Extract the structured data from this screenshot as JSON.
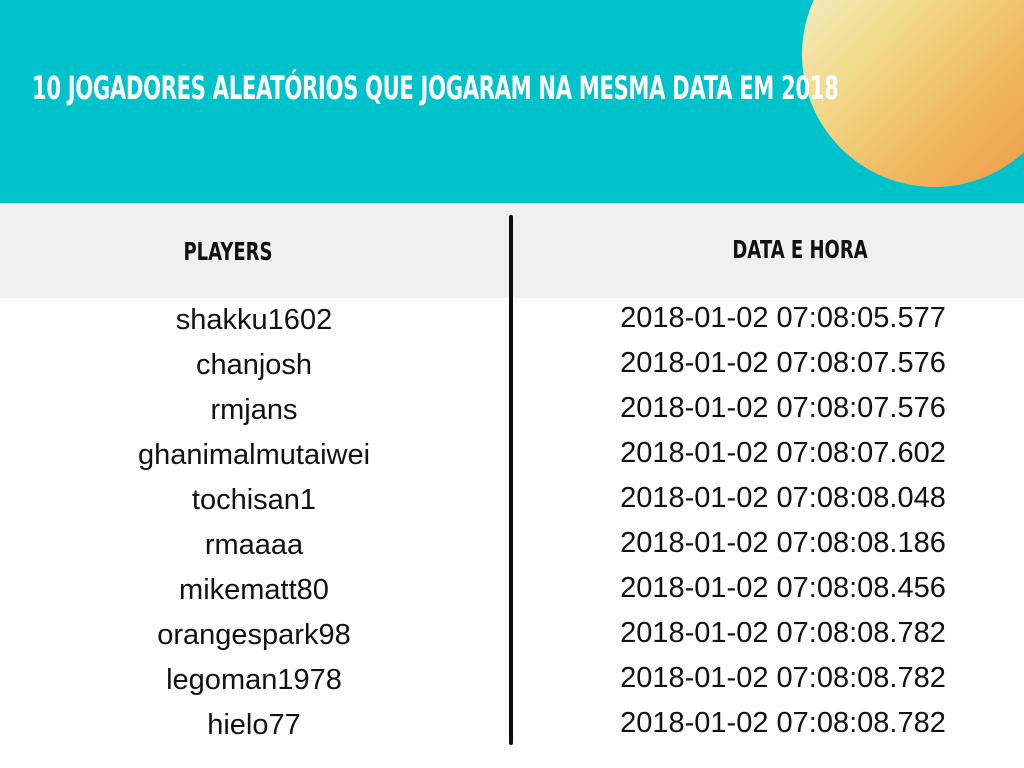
{
  "banner": {
    "title": "10 JOGADORES ALEATÓRIOS QUE JOGARAM NA MESMA DATA EM 2018",
    "background_color": "#00c2cb",
    "orb_colors": [
      "#f4f4dc",
      "#f0b45a",
      "#ec954a"
    ]
  },
  "table": {
    "headers": {
      "players": "PLAYERS",
      "datetime": "DATA E HORA"
    },
    "header_background": "#f0f0f0",
    "rows": [
      {
        "player": "shakku1602",
        "datetime": "2018-01-02 07:08:05.577"
      },
      {
        "player": "chanjosh",
        "datetime": "2018-01-02 07:08:07.576"
      },
      {
        "player": "rmjans",
        "datetime": "2018-01-02 07:08:07.576"
      },
      {
        "player": "ghanimalmutaiwei",
        "datetime": "2018-01-02 07:08:07.602"
      },
      {
        "player": "tochisan1",
        "datetime": "2018-01-02 07:08:08.048"
      },
      {
        "player": "rmaaaa",
        "datetime": "2018-01-02 07:08:08.186"
      },
      {
        "player": "mikematt80",
        "datetime": "2018-01-02 07:08:08.456"
      },
      {
        "player": "orangespark98",
        "datetime": "2018-01-02 07:08:08.782"
      },
      {
        "player": "legoman1978",
        "datetime": "2018-01-02 07:08:08.782"
      },
      {
        "player": "hielo77",
        "datetime": "2018-01-02 07:08:08.782"
      }
    ]
  }
}
